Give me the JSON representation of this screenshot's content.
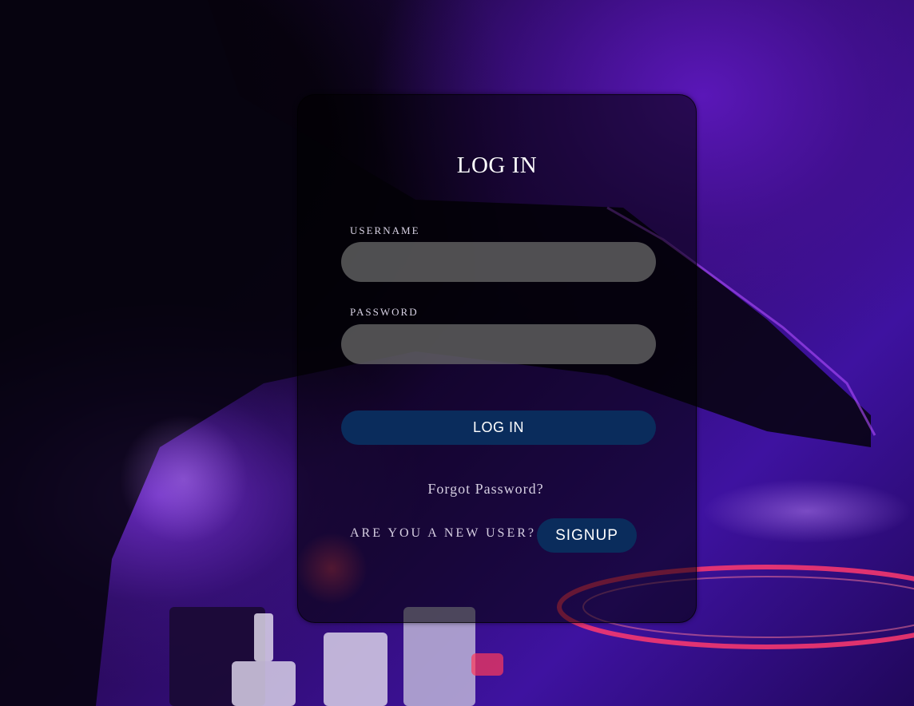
{
  "login": {
    "title": "LOG IN",
    "username_label": "USERNAME",
    "username_value": "",
    "password_label": "PASSWORD",
    "password_value": "",
    "submit_label": "LOG IN",
    "forgot_label": "Forgot Password?",
    "new_user_text": "ARE YOU A NEW USER?",
    "signup_label": "SIGNUP"
  },
  "theme": {
    "button_color": "#0a2c5c",
    "input_color": "#6e6e6e"
  }
}
